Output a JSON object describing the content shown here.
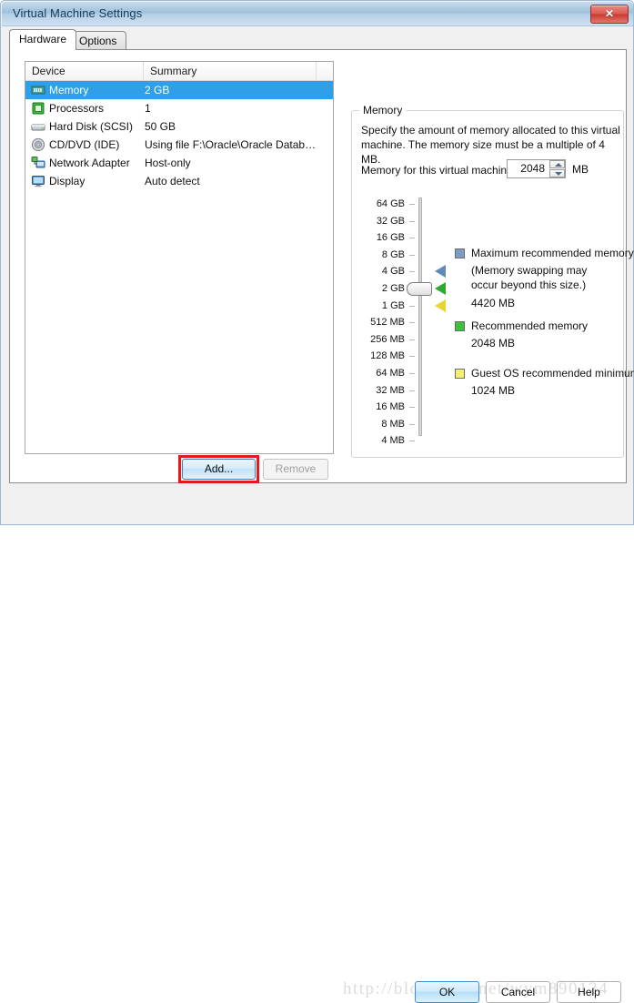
{
  "window": {
    "title": "Virtual Machine Settings",
    "close_label": "✕"
  },
  "tabs": [
    {
      "label": "Hardware",
      "active": true
    },
    {
      "label": "Options",
      "active": false
    }
  ],
  "device_list": {
    "columns": [
      "Device",
      "Summary",
      ""
    ],
    "rows": [
      {
        "icon": "memory-icon",
        "device": "Memory",
        "summary": "2 GB",
        "selected": true
      },
      {
        "icon": "processor-icon",
        "device": "Processors",
        "summary": "1",
        "selected": false
      },
      {
        "icon": "hard-disk-icon",
        "device": "Hard Disk (SCSI)",
        "summary": "50 GB",
        "selected": false
      },
      {
        "icon": "cd-dvd-icon",
        "device": "CD/DVD (IDE)",
        "summary": "Using file F:\\Oracle\\Oracle Datab…",
        "selected": false
      },
      {
        "icon": "network-adapter-icon",
        "device": "Network Adapter",
        "summary": "Host-only",
        "selected": false
      },
      {
        "icon": "display-icon",
        "device": "Display",
        "summary": "Auto detect",
        "selected": false
      }
    ]
  },
  "list_buttons": {
    "add": "Add...",
    "remove": "Remove"
  },
  "memory_panel": {
    "group_label": "Memory",
    "description": "Specify the amount of memory allocated to this virtual machine. The memory size must be a multiple of 4 MB.",
    "field_label": "Memory for this virtual machine:",
    "value": "2048",
    "unit": "MB",
    "spin_up": "▲",
    "spin_down": "▼"
  },
  "scale": {
    "ticks": [
      "64 GB",
      "32 GB",
      "16 GB",
      "8 GB",
      "4 GB",
      "2 GB",
      "1 GB",
      "512 MB",
      "256 MB",
      "128 MB",
      "64 MB",
      "32 MB",
      "16 MB",
      "8 MB",
      "4 MB"
    ],
    "current_tick": "2 GB"
  },
  "markers": [
    {
      "name": "maximum-recommended-marker",
      "tick": "4 GB",
      "color": "#6389b8"
    },
    {
      "name": "recommended-marker",
      "tick": "2 GB",
      "color": "#2eaa2e"
    },
    {
      "name": "guest-minimum-marker",
      "tick": "1 GB",
      "color": "#e8d532"
    }
  ],
  "legend": [
    {
      "name": "maximum-recommended-memory",
      "color": "#7d9cc4",
      "title": "Maximum recommended memory",
      "note": "(Memory swapping may\noccur beyond this size.)",
      "value": "4420 MB"
    },
    {
      "name": "recommended-memory",
      "color": "#39c23a",
      "title": "Recommended memory",
      "note": "",
      "value": "2048 MB"
    },
    {
      "name": "guest-os-recommended-minimum",
      "color": "#f5ef6a",
      "title": "Guest OS recommended minimum",
      "note": "",
      "value": "1024 MB"
    }
  ],
  "dialog_buttons": {
    "ok": "OK",
    "cancel": "Cancel",
    "help": "Help"
  },
  "watermark": "http://blog.csdn.net/wym890124"
}
